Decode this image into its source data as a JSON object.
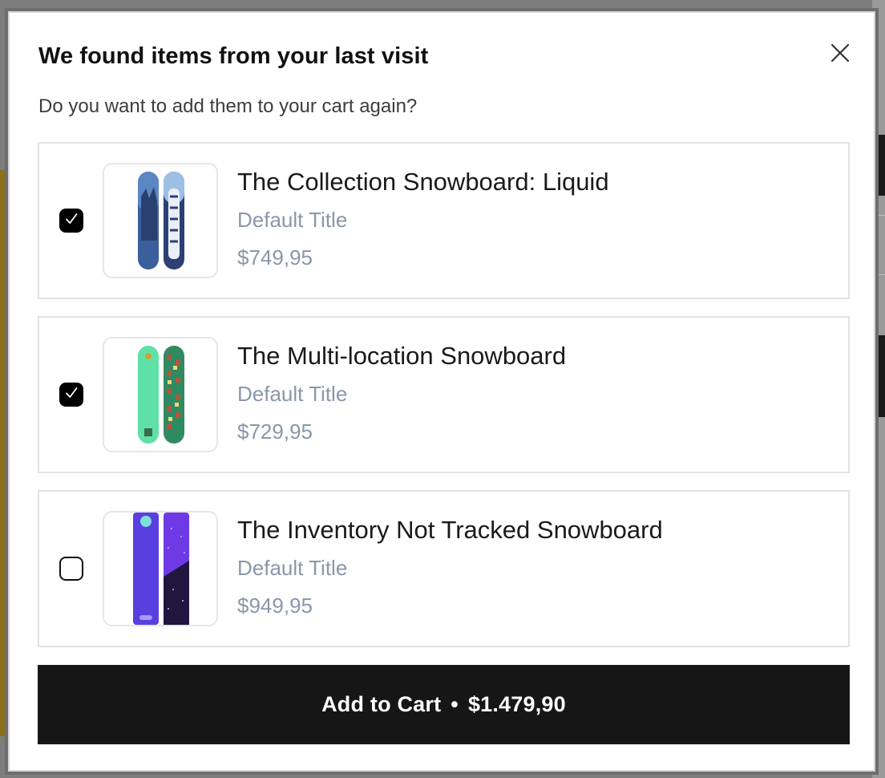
{
  "modal": {
    "title": "We found items from your last visit",
    "subtitle": "Do you want to add them to your cart again?",
    "close_icon": "close-icon"
  },
  "items": [
    {
      "name": "The Collection Snowboard: Liquid",
      "variant": "Default Title",
      "price": "$749,95",
      "checked": true
    },
    {
      "name": "The Multi-location Snowboard",
      "variant": "Default Title",
      "price": "$729,95",
      "checked": true
    },
    {
      "name": "The Inventory Not Tracked Snowboard",
      "variant": "Default Title",
      "price": "$949,95",
      "checked": false
    }
  ],
  "cta": {
    "label": "Add to Cart",
    "separator": "•",
    "total": "$1.479,90"
  },
  "colors": {
    "button_bg": "#161616",
    "muted_text": "#8a97aa",
    "border": "#e3e3e3"
  }
}
